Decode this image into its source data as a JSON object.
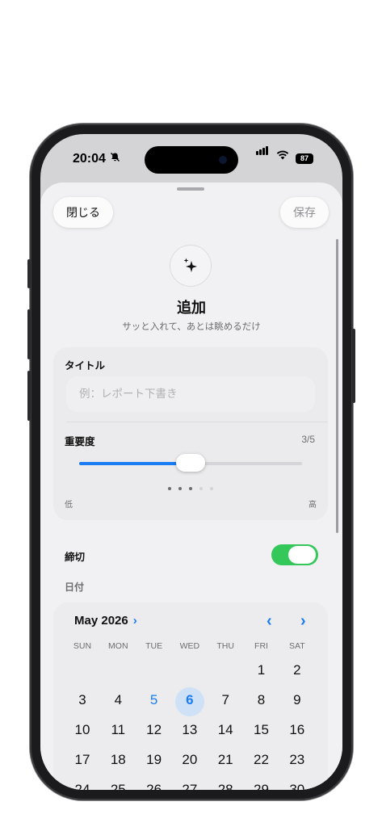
{
  "status": {
    "time": "20:04",
    "battery": "87"
  },
  "sheet": {
    "close_label": "閉じる",
    "save_label": "保存",
    "title": "追加",
    "subtitle": "サッと入れて、あとは眺めるだけ"
  },
  "title_field": {
    "label": "タイトル",
    "placeholder": "例：レポート下書き"
  },
  "importance": {
    "label": "重要度",
    "value_text": "3/5",
    "value": 3,
    "max": 5,
    "fraction": 0.5,
    "min_label": "低",
    "max_label": "高"
  },
  "deadline": {
    "label": "締切",
    "enabled": true,
    "date_label": "日付"
  },
  "calendar": {
    "month_label": "May 2026",
    "weekdays": [
      "SUN",
      "MON",
      "TUE",
      "WED",
      "THU",
      "FRI",
      "SAT"
    ],
    "weeks": [
      [
        "",
        "",
        "",
        "",
        "",
        "1",
        "2"
      ],
      [
        "3",
        "4",
        "5",
        "6",
        "7",
        "8",
        "9"
      ],
      [
        "10",
        "11",
        "12",
        "13",
        "14",
        "15",
        "16"
      ],
      [
        "17",
        "18",
        "19",
        "20",
        "21",
        "22",
        "23"
      ],
      [
        "24",
        "25",
        "26",
        "27",
        "28",
        "29",
        "30"
      ]
    ],
    "today": "5",
    "selected": "6"
  },
  "colors": {
    "accent": "#1a7cf2",
    "toggle_on": "#34c759",
    "selected_bg": "#cfe1f7"
  },
  "icons": [
    "sparkles-icon",
    "chevron-right-icon",
    "chevron-left-icon",
    "bell-slash-icon",
    "wifi-icon",
    "signal-icon"
  ]
}
